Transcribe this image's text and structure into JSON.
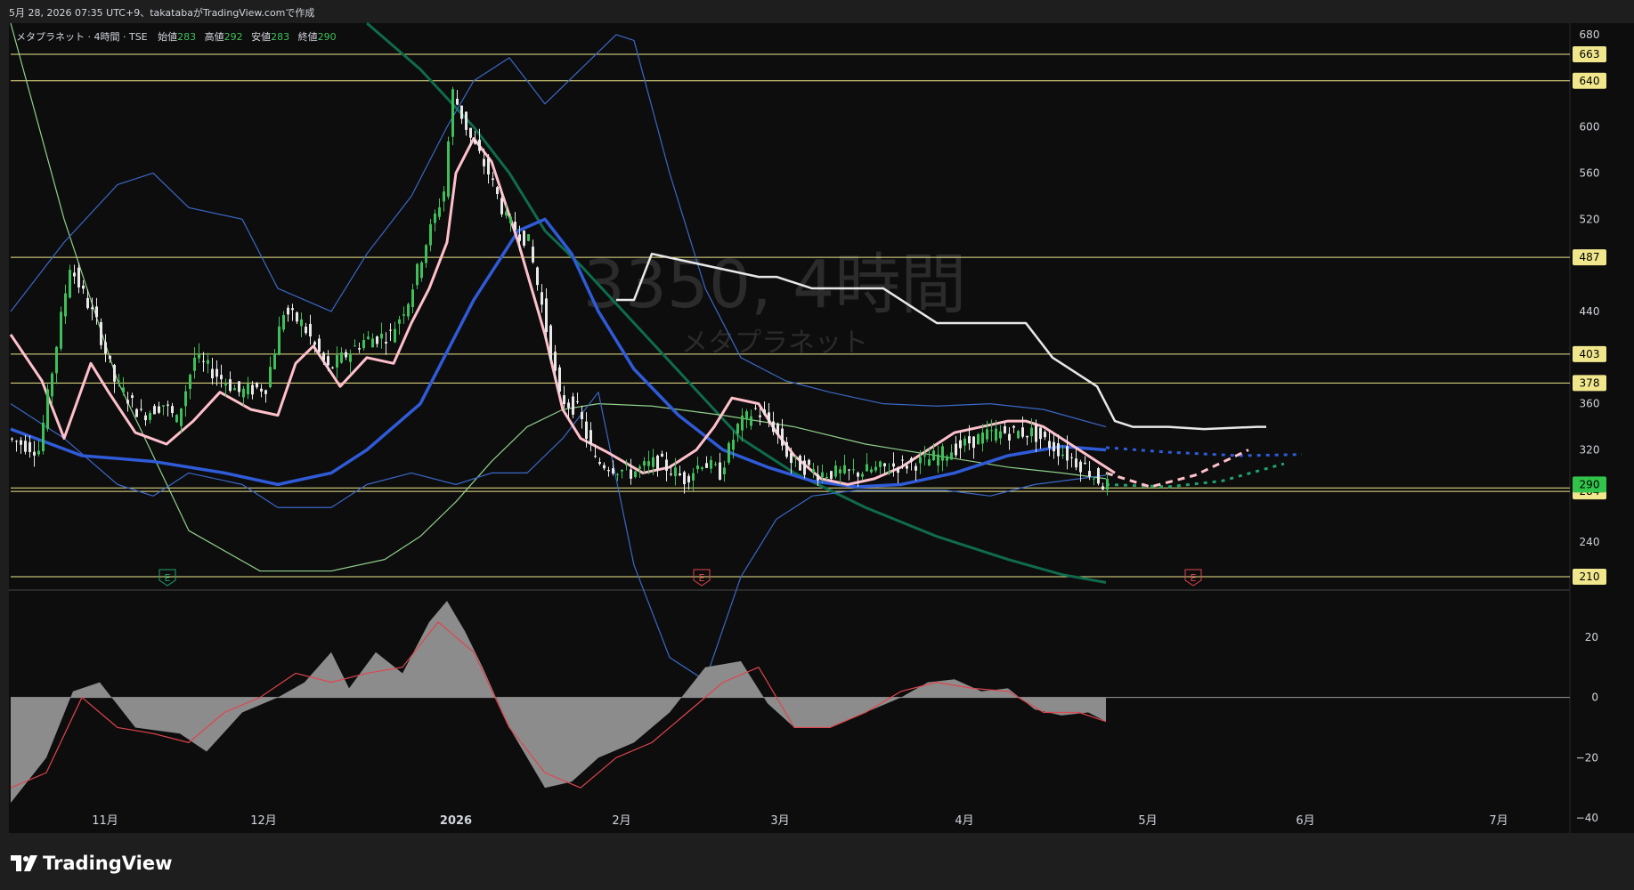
{
  "header": {
    "text": "5月 28, 2026 07:35 UTC+9、takatabaがTradingView.comで作成"
  },
  "legend": {
    "symbol_label": "メタプラネット · 4時間 · TSE",
    "open_label": "始値",
    "open": "283",
    "high_label": "高値",
    "high": "292",
    "low_label": "安値",
    "low": "283",
    "close_label": "終値",
    "close": "290"
  },
  "watermark": {
    "main": "3350, 4時間",
    "sub": "メタプラネット"
  },
  "brand": {
    "name": "TradingView",
    "icon": "tradingview-logo-icon"
  },
  "colors": {
    "background": "#0d0d0d",
    "up": "#3fbf5a",
    "down": "#e8e8e8",
    "level": "#f0e68c",
    "ma_fast": "#ffc0cb",
    "ma_mid": "#2f5bd9",
    "bb": "#3a68c8",
    "macd_hist": "#8c8c8c",
    "macd_signal": "#e0454e",
    "last_price": "#31c34a",
    "earnings": "#e0454e"
  },
  "chart_data": [
    {
      "type": "line",
      "subtype": "candlestick-with-indicators",
      "y_axis": {
        "min": 200,
        "max": 690,
        "ticks": [
          680,
          600,
          560,
          520,
          440,
          360,
          320,
          240
        ]
      },
      "x_axis": {
        "labels": [
          "11月",
          "12月",
          "2026",
          "2月",
          "3月",
          "4月",
          "5月",
          "6月",
          "7月"
        ]
      },
      "horizontal_levels": [
        663,
        640,
        487,
        403,
        378,
        287,
        284,
        210
      ],
      "last_price": 290,
      "earnings_markers": [
        "E",
        "E",
        "E"
      ],
      "price_path": {
        "x": [
          0,
          35,
          70,
          100,
          120,
          150,
          175,
          190,
          210,
          235,
          260,
          290,
          310,
          330,
          360,
          400,
          430,
          450,
          470,
          490,
          500,
          520,
          540,
          560,
          585,
          600,
          620,
          640,
          660,
          700,
          730,
          760,
          780,
          800,
          820,
          840,
          860,
          880,
          910,
          950,
          990,
          1030,
          1060,
          1090,
          1110,
          1130,
          1150,
          1170,
          1190,
          1210,
          1230
        ],
        "y": [
          330,
          320,
          480,
          430,
          380,
          350,
          360,
          345,
          400,
          385,
          370,
          375,
          440,
          430,
          390,
          415,
          420,
          450,
          500,
          545,
          630,
          590,
          560,
          520,
          500,
          445,
          365,
          355,
          310,
          300,
          310,
          295,
          310,
          300,
          340,
          355,
          340,
          310,
          300,
          300,
          305,
          310,
          320,
          330,
          335,
          335,
          335,
          325,
          315,
          305,
          290
        ]
      },
      "ma_fast": {
        "x": [
          0,
          35,
          60,
          90,
          110,
          140,
          175,
          205,
          235,
          270,
          300,
          320,
          340,
          370,
          400,
          430,
          450,
          470,
          490,
          500,
          520,
          540,
          570,
          600,
          620,
          640,
          670,
          710,
          740,
          770,
          790,
          810,
          840,
          860,
          880,
          910,
          940,
          970,
          1000,
          1030,
          1060,
          1090,
          1120,
          1140,
          1160,
          1180,
          1200,
          1220,
          1240
        ],
        "y": [
          420,
          380,
          330,
          395,
          370,
          335,
          325,
          345,
          370,
          355,
          350,
          395,
          410,
          375,
          400,
          395,
          430,
          460,
          500,
          560,
          590,
          570,
          500,
          420,
          355,
          330,
          318,
          300,
          305,
          320,
          340,
          365,
          360,
          335,
          315,
          295,
          290,
          295,
          305,
          320,
          335,
          340,
          345,
          345,
          340,
          330,
          320,
          310,
          300
        ]
      },
      "ma_mid": {
        "x": [
          0,
          80,
          160,
          240,
          300,
          360,
          400,
          460,
          520,
          570,
          600,
          630,
          660,
          700,
          750,
          800,
          850,
          900,
          950,
          1000,
          1060,
          1120,
          1180,
          1230
        ],
        "y": [
          338,
          315,
          310,
          300,
          290,
          300,
          320,
          360,
          450,
          510,
          520,
          490,
          440,
          390,
          350,
          320,
          305,
          293,
          288,
          290,
          300,
          315,
          323,
          320
        ]
      },
      "bb_upper": {
        "x": [
          0,
          60,
          120,
          160,
          200,
          260,
          300,
          360,
          400,
          450,
          490,
          520,
          560,
          600,
          640,
          680,
          700,
          740,
          780,
          820,
          870,
          920,
          980,
          1040,
          1100,
          1160,
          1230
        ],
        "y": [
          440,
          500,
          550,
          560,
          530,
          520,
          460,
          440,
          490,
          540,
          600,
          640,
          660,
          620,
          650,
          680,
          675,
          560,
          460,
          400,
          380,
          370,
          360,
          358,
          360,
          355,
          340
        ]
      },
      "bb_lower": {
        "x": [
          0,
          60,
          120,
          160,
          200,
          260,
          300,
          360,
          400,
          450,
          500,
          540,
          580,
          620,
          660,
          700,
          740,
          780,
          820,
          860,
          900,
          950,
          1000,
          1050,
          1100,
          1150,
          1230
        ],
        "y": [
          360,
          330,
          290,
          280,
          300,
          290,
          270,
          270,
          290,
          300,
          290,
          300,
          300,
          330,
          370,
          220,
          140,
          120,
          210,
          260,
          280,
          285,
          285,
          285,
          280,
          290,
          298
        ]
      },
      "long_ma": {
        "x": [
          0,
          60,
          120,
          200,
          280,
          360,
          420,
          460,
          500,
          540,
          580,
          620,
          660,
          720,
          800,
          880,
          960,
          1040,
          1120,
          1180,
          1230
        ],
        "y": [
          690,
          520,
          380,
          250,
          215,
          215,
          225,
          245,
          275,
          310,
          340,
          355,
          360,
          358,
          350,
          340,
          325,
          315,
          305,
          300,
          295
        ]
      },
      "trend_line": {
        "x": [
          400,
          460,
          520,
          560,
          600,
          640,
          700,
          760,
          820,
          880,
          960,
          1040,
          1120,
          1180,
          1230
        ],
        "y": [
          690,
          650,
          600,
          560,
          510,
          480,
          430,
          380,
          330,
          300,
          270,
          245,
          225,
          212,
          205
        ]
      },
      "ichimoku_line": {
        "x": [
          680,
          700,
          720,
          840,
          860,
          900,
          980,
          1040,
          1140,
          1170,
          1220,
          1240,
          1260,
          1300,
          1340,
          1400,
          1410
        ],
        "y": [
          450,
          450,
          490,
          470,
          470,
          460,
          460,
          430,
          430,
          400,
          375,
          345,
          340,
          340,
          338,
          340,
          340
        ]
      },
      "projections": {
        "blue_x": [
          1230,
          1300,
          1380,
          1450
        ],
        "blue_y": [
          322,
          318,
          315,
          316
        ],
        "green_x": [
          1230,
          1300,
          1360,
          1430
        ],
        "green_y": [
          290,
          288,
          293,
          308
        ],
        "pink_x": [
          1230,
          1280,
          1330,
          1390
        ],
        "pink_y": [
          300,
          288,
          298,
          320
        ]
      }
    },
    {
      "type": "area",
      "subtype": "macd-histogram",
      "y_axis": {
        "min": -45,
        "max": 35,
        "ticks": [
          20,
          0,
          -20,
          -40
        ]
      },
      "histogram": {
        "x": [
          0,
          40,
          70,
          100,
          140,
          190,
          220,
          260,
          300,
          330,
          360,
          380,
          410,
          440,
          470,
          490,
          510,
          530,
          560,
          600,
          630,
          660,
          700,
          740,
          780,
          820,
          850,
          880,
          920,
          960,
          1000,
          1030,
          1060,
          1090,
          1120,
          1150,
          1180,
          1210,
          1230
        ],
        "y": [
          -35,
          -20,
          2,
          5,
          -10,
          -12,
          -18,
          -5,
          0,
          5,
          15,
          3,
          15,
          8,
          25,
          32,
          22,
          10,
          -10,
          -30,
          -28,
          -20,
          -15,
          -5,
          10,
          12,
          -2,
          -10,
          -10,
          -5,
          0,
          5,
          6,
          2,
          3,
          -4,
          -6,
          -5,
          -8
        ]
      },
      "signal": {
        "x": [
          0,
          40,
          80,
          120,
          160,
          200,
          240,
          280,
          320,
          360,
          400,
          440,
          480,
          520,
          560,
          600,
          640,
          680,
          720,
          760,
          800,
          840,
          880,
          920,
          960,
          1000,
          1040,
          1080,
          1120,
          1160,
          1200,
          1230
        ],
        "y": [
          -30,
          -25,
          0,
          -10,
          -12,
          -15,
          -5,
          0,
          8,
          5,
          8,
          10,
          25,
          15,
          -10,
          -25,
          -30,
          -20,
          -15,
          -5,
          5,
          10,
          -10,
          -10,
          -5,
          2,
          5,
          3,
          2,
          -5,
          -5,
          -8
        ]
      }
    }
  ]
}
